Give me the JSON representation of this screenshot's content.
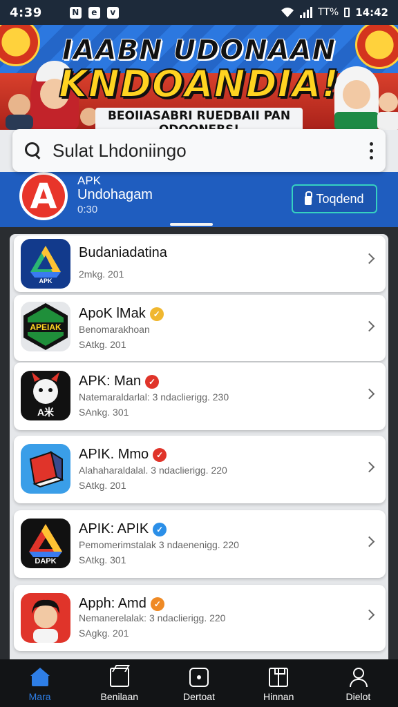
{
  "status_bar": {
    "time": "4:39",
    "notifications": [
      "N",
      "e",
      "v"
    ],
    "network": "TT%",
    "clock": "14:42"
  },
  "banner": {
    "title_line1": "IAABN UDONAAN",
    "title_line2": "KNDOANDIA!",
    "tagline": "BEOIIASABRI RUEDBAII PAN ODOONEBS!",
    "colors": {
      "blue": "#1e5fc9",
      "red": "#c83a2a",
      "yellow": "#ffd321"
    }
  },
  "search": {
    "value": "Sulat Lhdoniingo",
    "icon": "search-icon",
    "menu_icon": "kebab-icon"
  },
  "featured": {
    "label": "APK",
    "name": "Undohagam",
    "meta": "0:30",
    "button_label": "Toqdend",
    "button_icon": "lock-icon",
    "logo_glyph": "A"
  },
  "apps": [
    {
      "name": "Budaniadatina",
      "desc": "",
      "meta": "2mkg. 201",
      "badge": "",
      "badge_color": ""
    },
    {
      "name": "ApoK lMak",
      "desc": "Benomarakhoan",
      "meta": "SAtkg. 201",
      "badge": "✓",
      "badge_color": "#f0b72f"
    },
    {
      "name": "APK: Man",
      "desc": "Natemaraldarlal: 3 ndaclierigg. 230",
      "meta": "SAnkg. 301",
      "badge": "✓",
      "badge_color": "#e0342a"
    },
    {
      "name": "APIK. Mmo",
      "desc": "Alahaharaldalal. 3 ndaclierigg. 220",
      "meta": "SAtkg. 201",
      "badge": "✓",
      "badge_color": "#e0342a"
    },
    {
      "name": "APIK: APIK",
      "desc": "Pemomerimstalak 3 ndaenenigg. 220",
      "meta": "SAtkg. 301",
      "badge": "✓",
      "badge_color": "#2b8fe8"
    },
    {
      "name": "Apph: Amd",
      "desc": "Nemanerelalak: 3 ndaclierigg. 220",
      "meta": "SAgkg. 201",
      "badge": "✓",
      "badge_color": "#ef8a25"
    }
  ],
  "app_icon_labels": [
    "APK",
    "APEIAK",
    "A米",
    "",
    "DAPK",
    ""
  ],
  "bottom_nav": [
    {
      "label": "Mara",
      "icon": "home-icon",
      "active": true
    },
    {
      "label": "Benilaan",
      "icon": "box-icon",
      "active": false
    },
    {
      "label": "Dertoat",
      "icon": "download-icon",
      "active": false
    },
    {
      "label": "Hinnan",
      "icon": "book-icon",
      "active": false
    },
    {
      "label": "Dielot",
      "icon": "user-icon",
      "active": false
    }
  ]
}
